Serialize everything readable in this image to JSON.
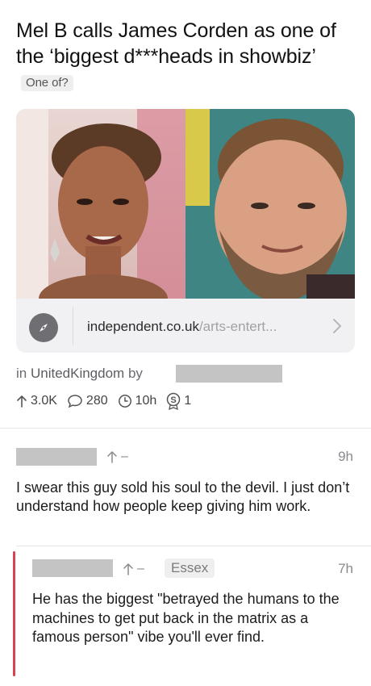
{
  "post": {
    "title": "Mel B calls James Corden as one of the ‘biggest d***heads in showbiz’",
    "flair": "One of?"
  },
  "link": {
    "domain": "independent.co.uk",
    "path": "/arts-entert...",
    "icon": "compass-icon",
    "chevron": "chevron-right-icon"
  },
  "meta": {
    "prefix": "in",
    "subreddit": "UnitedKingdom",
    "by": "by"
  },
  "stats": {
    "upvotes": "3.0K",
    "comments": "280",
    "age": "10h",
    "awards": "1"
  },
  "comment": {
    "vote_score": "–",
    "time": "9h",
    "body": "I swear this guy sold his soul to the devil. I just don’t understand how people keep giving him work."
  },
  "reply": {
    "vote_score": "–",
    "flair": "Essex",
    "time": "7h",
    "body": "He has the biggest \"betrayed the humans to the machines to get put back in the matrix as a famous person\" vibe you'll ever find."
  },
  "colors": {
    "reply_thread_bar": "#d9434f",
    "redaction": "#c4c4c4",
    "card_background": "#f1f1f3"
  }
}
